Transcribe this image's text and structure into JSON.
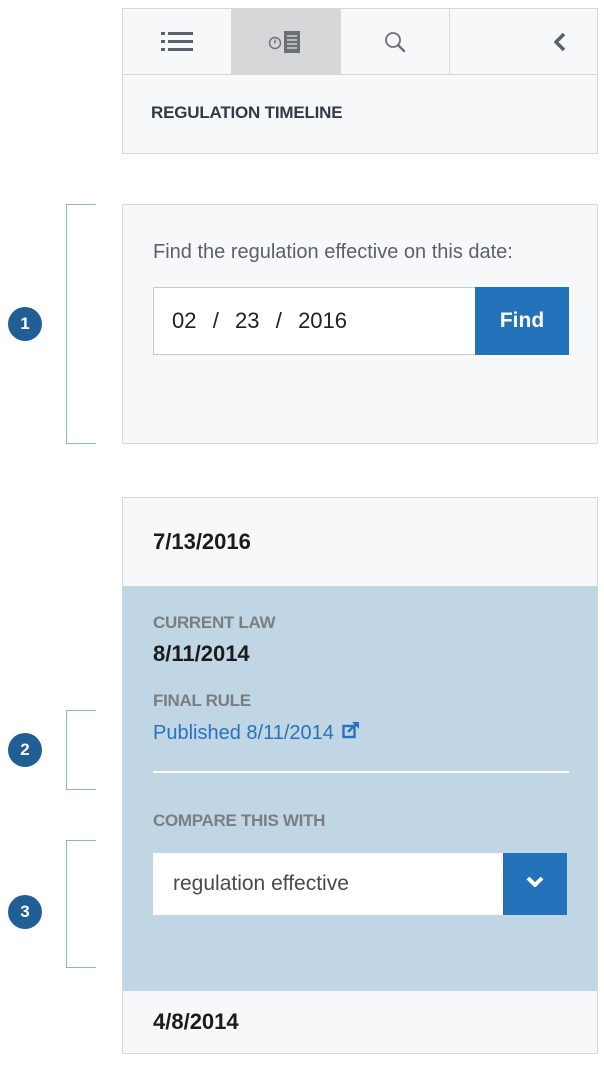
{
  "tabs": [
    {
      "name": "table-of-contents",
      "icon": "list-icon",
      "active": false
    },
    {
      "name": "timeline",
      "icon": "clock-document-icon",
      "active": true
    },
    {
      "name": "search",
      "icon": "search-icon",
      "active": false
    },
    {
      "name": "collapse",
      "icon": "chevron-left-icon",
      "active": false
    }
  ],
  "header": {
    "title": "REGULATION TIMELINE"
  },
  "callouts": [
    "1",
    "2",
    "3"
  ],
  "find": {
    "label": "Find the regulation effective on this date:",
    "date_value": "02  /  23  /  2016",
    "button_label": "Find"
  },
  "timeline": {
    "top_date": "7/13/2016",
    "current": {
      "label": "CURRENT LAW",
      "date": "8/11/2014",
      "rule_label": "FINAL RULE",
      "rule_link": "Published 8/11/2014",
      "compare_label": "COMPARE THIS WITH",
      "compare_value": "regulation effective"
    },
    "bottom_date": "4/8/2014"
  },
  "colors": {
    "accent": "#2472b9",
    "badge": "#1f5f96",
    "current_bg": "#c0d6e4",
    "active_tab": "#d6d7d9"
  }
}
